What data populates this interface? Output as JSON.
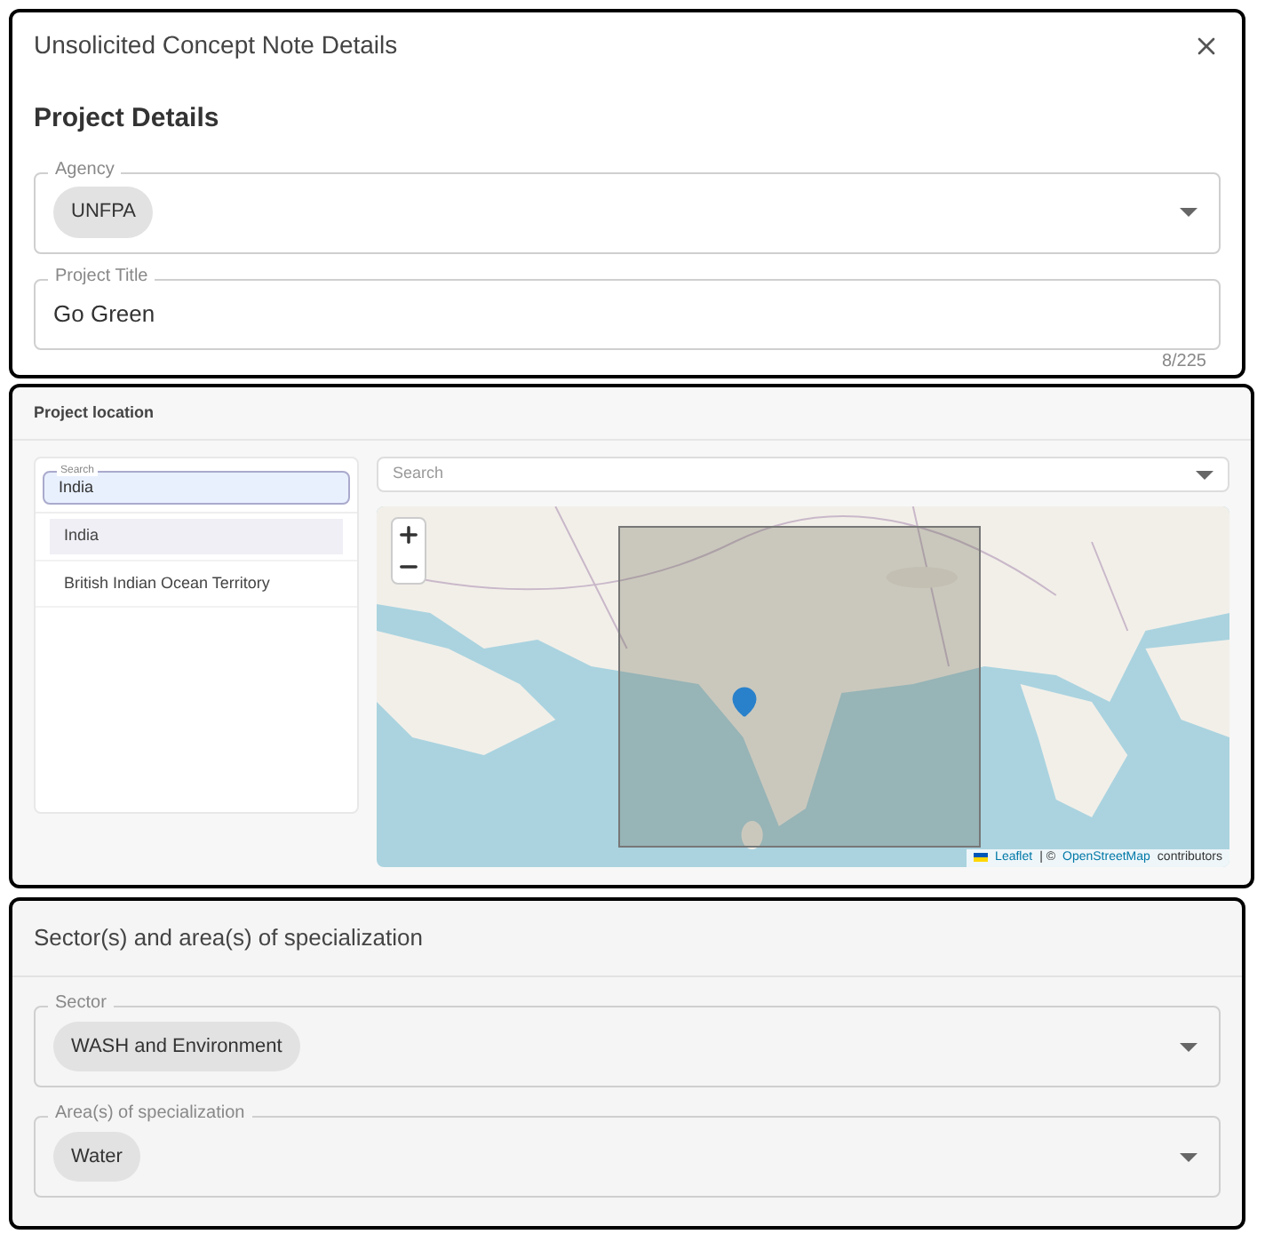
{
  "dialog": {
    "title": "Unsolicited Concept Note Details",
    "section_title": "Project Details",
    "agency": {
      "label": "Agency",
      "chips": [
        "UNFPA"
      ]
    },
    "project_title": {
      "label": "Project Title",
      "value": "Go Green",
      "counter": "8/225"
    }
  },
  "location": {
    "title": "Project location",
    "search": {
      "label": "Search",
      "value": "India"
    },
    "results": [
      {
        "label": "India",
        "selected": true
      },
      {
        "label": "British Indian Ocean Territory",
        "selected": false
      }
    ],
    "map_search": {
      "placeholder": "Search"
    },
    "attribution": {
      "leaflet": "Leaflet",
      "separator": "| ©",
      "osm": "OpenStreetMap",
      "suffix": "contributors"
    }
  },
  "sectors": {
    "title": "Sector(s) and area(s) of specialization",
    "fields": [
      {
        "label": "Sector",
        "chips": [
          "WASH and Environment"
        ]
      },
      {
        "label": "Area(s) of specialization",
        "chips": [
          "Water"
        ]
      }
    ]
  }
}
